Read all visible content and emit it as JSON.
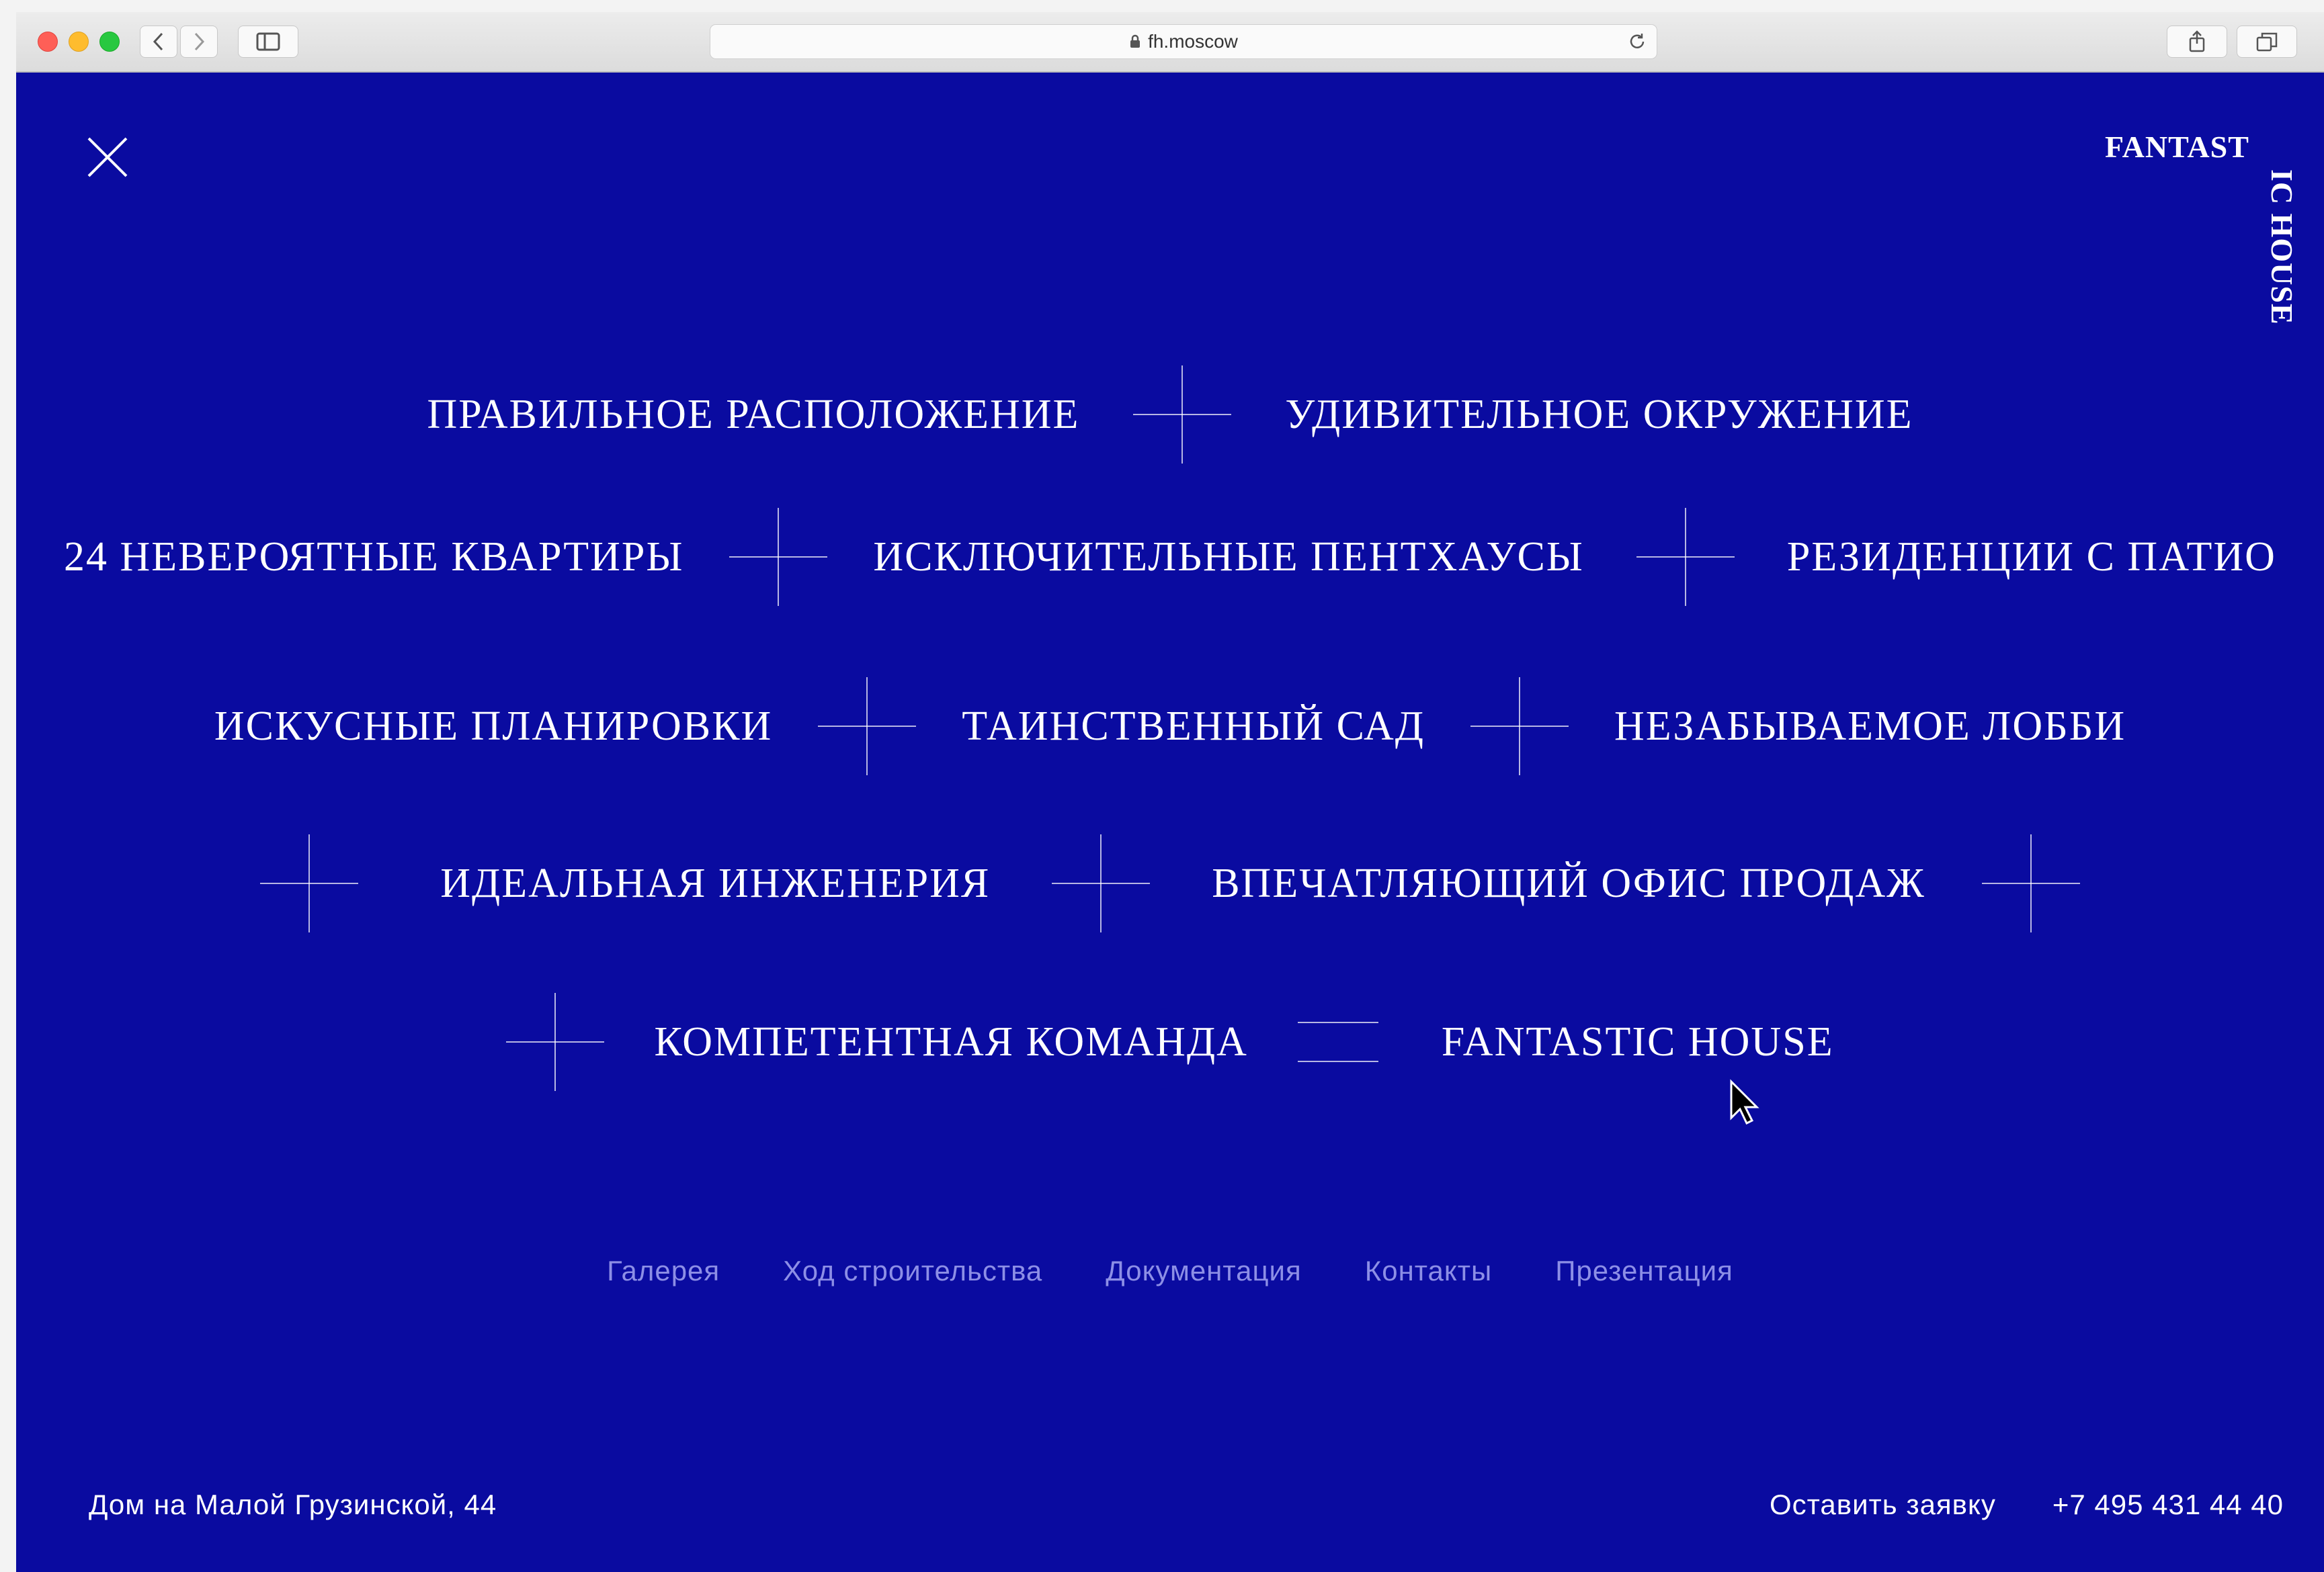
{
  "browser": {
    "url": "fh.moscow",
    "icons": [
      "back-icon",
      "forward-icon",
      "sidebar-icon",
      "lock-icon",
      "reload-icon",
      "share-icon",
      "tabs-icon"
    ]
  },
  "logo": {
    "line1": "FANTAST",
    "line2": "IC HOUSE"
  },
  "menu": {
    "row1": [
      "ПРАВИЛЬНОЕ РАСПОЛОЖЕНИЕ",
      "УДИВИТЕЛЬНОЕ ОКРУЖЕНИЕ"
    ],
    "row2": [
      "24 НЕВЕРОЯТНЫЕ КВАРТИРЫ",
      "ИСКЛЮЧИТЕЛЬНЫЕ ПЕНТХАУСЫ",
      "РЕЗИДЕНЦИИ С ПАТИО"
    ],
    "row3": [
      "ИСКУСНЫЕ ПЛАНИРОВКИ",
      "ТАИНСТВЕННЫЙ САД",
      "НЕЗАБЫВАЕМОЕ ЛОББИ"
    ],
    "row4": [
      "ИДЕАЛЬНАЯ ИНЖЕНЕРИЯ",
      "ВПЕЧАТЛЯЮЩИЙ ОФИС ПРОДАЖ"
    ],
    "row5": [
      "КОМПЕТЕНТНАЯ КОМАНДА",
      "FANTASTIC HOUSE"
    ]
  },
  "sub_nav": [
    "Галерея",
    "Ход строительства",
    "Документация",
    "Контакты",
    "Презентация"
  ],
  "footer": {
    "address": "Дом на Малой Грузинской, 44",
    "request": "Оставить заявку",
    "phone": "+7 495 431 44 40"
  },
  "colors": {
    "background": "#0a0ba0",
    "text": "#ffffff",
    "muted_link": "#8d8fe6"
  }
}
